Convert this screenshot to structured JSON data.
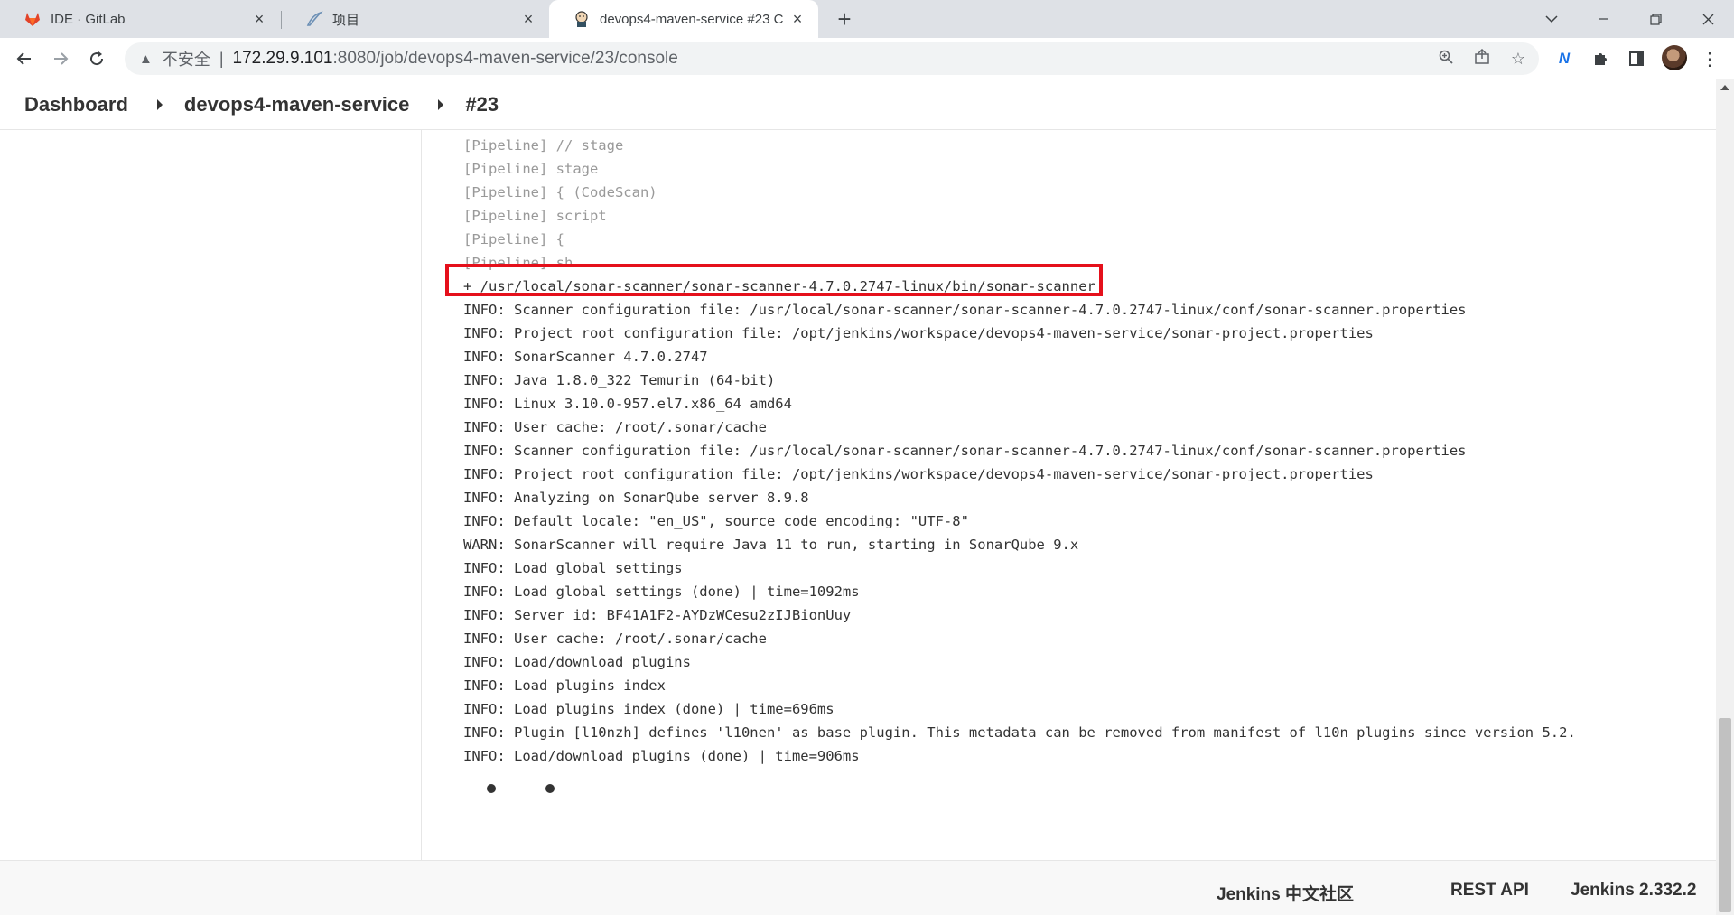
{
  "browser": {
    "tabs": [
      {
        "title": "IDE · GitLab",
        "icon": "gitlab-icon",
        "active": false
      },
      {
        "title": "项目",
        "icon": "feather-icon",
        "active": false
      },
      {
        "title": "devops4-maven-service #23 C",
        "icon": "jenkins-icon",
        "active": true
      }
    ],
    "new_tab_label": "+",
    "address": {
      "security_label": "不安全",
      "divider": "|",
      "host": "172.29.9.101",
      "path": ":8080/job/devops4-maven-service/23/console"
    }
  },
  "breadcrumb": {
    "items": [
      "Dashboard",
      "devops4-maven-service",
      "#23"
    ]
  },
  "console": {
    "lines": [
      {
        "text": "[Pipeline] // stage",
        "faded": true
      },
      {
        "text": "[Pipeline] stage",
        "faded": true
      },
      {
        "text": "[Pipeline] { (CodeScan)",
        "faded": true
      },
      {
        "text": "[Pipeline] script",
        "faded": true
      },
      {
        "text": "[Pipeline] {",
        "faded": true
      },
      {
        "text": "[Pipeline] sh",
        "faded": true
      },
      {
        "text": "+ /usr/local/sonar-scanner/sonar-scanner-4.7.0.2747-linux/bin/sonar-scanner",
        "faded": false
      },
      {
        "text": "INFO: Scanner configuration file: /usr/local/sonar-scanner/sonar-scanner-4.7.0.2747-linux/conf/sonar-scanner.properties",
        "faded": false
      },
      {
        "text": "INFO: Project root configuration file: /opt/jenkins/workspace/devops4-maven-service/sonar-project.properties",
        "faded": false
      },
      {
        "text": "INFO: SonarScanner 4.7.0.2747",
        "faded": false
      },
      {
        "text": "INFO: Java 1.8.0_322 Temurin (64-bit)",
        "faded": false
      },
      {
        "text": "INFO: Linux 3.10.0-957.el7.x86_64 amd64",
        "faded": false
      },
      {
        "text": "INFO: User cache: /root/.sonar/cache",
        "faded": false
      },
      {
        "text": "INFO: Scanner configuration file: /usr/local/sonar-scanner/sonar-scanner-4.7.0.2747-linux/conf/sonar-scanner.properties",
        "faded": false
      },
      {
        "text": "INFO: Project root configuration file: /opt/jenkins/workspace/devops4-maven-service/sonar-project.properties",
        "faded": false
      },
      {
        "text": "INFO: Analyzing on SonarQube server 8.9.8",
        "faded": false
      },
      {
        "text": "INFO: Default locale: \"en_US\", source code encoding: \"UTF-8\"",
        "faded": false
      },
      {
        "text": "WARN: SonarScanner will require Java 11 to run, starting in SonarQube 9.x",
        "faded": false
      },
      {
        "text": "INFO: Load global settings",
        "faded": false
      },
      {
        "text": "INFO: Load global settings (done) | time=1092ms",
        "faded": false
      },
      {
        "text": "INFO: Server id: BF41A1F2-AYDzWCesu2zIJBionUuy",
        "faded": false
      },
      {
        "text": "INFO: User cache: /root/.sonar/cache",
        "faded": false
      },
      {
        "text": "INFO: Load/download plugins",
        "faded": false
      },
      {
        "text": "INFO: Load plugins index",
        "faded": false
      },
      {
        "text": "INFO: Load plugins index (done) | time=696ms",
        "faded": false
      },
      {
        "text": "INFO: Plugin [l10nzh] defines 'l10nen' as base plugin. This metadata can be removed from manifest of l10n plugins since version 5.2.",
        "faded": false
      },
      {
        "text": "INFO: Load/download plugins (done) | time=906ms",
        "faded": false
      }
    ],
    "highlight_color": "#e5101b"
  },
  "footer": {
    "community_label": "Jenkins 中文社区",
    "rest_api_label": "REST API",
    "version_label": "Jenkins 2.332.2"
  }
}
